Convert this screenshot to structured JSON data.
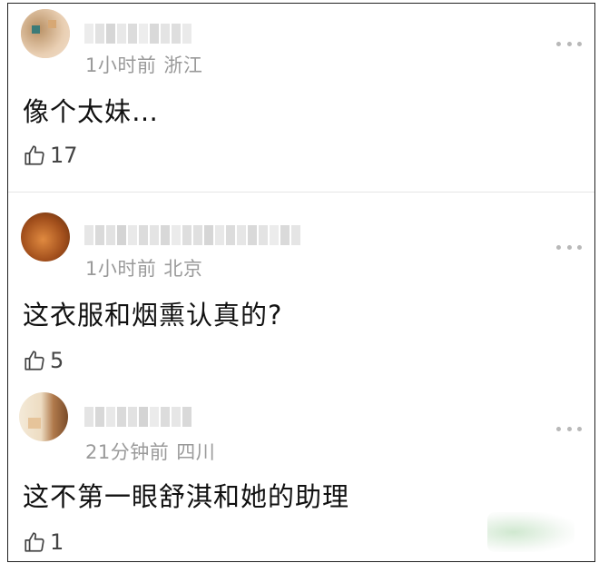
{
  "comments": [
    {
      "time": "1小时前",
      "location": "浙江",
      "text": "像个太妹…",
      "likes": "17",
      "avatar_colors": [
        "#c99a66",
        "#e4c3a2",
        "#b88a5e",
        "#f0d8c0"
      ]
    },
    {
      "time": "1小时前",
      "location": "北京",
      "text": "这衣服和烟熏认真的?",
      "likes": "5",
      "avatar_colors": [
        "#7a3b12",
        "#b6642a",
        "#e08a40",
        "#5a2a0c"
      ]
    },
    {
      "time": "21分钟前",
      "location": "四川",
      "text": "这不第一眼舒淇和她的助理",
      "likes": "1",
      "avatar_colors": [
        "#e9dcc8",
        "#f3e6d2",
        "#9a6a42",
        "#d9b68e"
      ]
    }
  ],
  "icons": {
    "like": "thumbs-up-icon",
    "more": "more-dots-icon"
  }
}
